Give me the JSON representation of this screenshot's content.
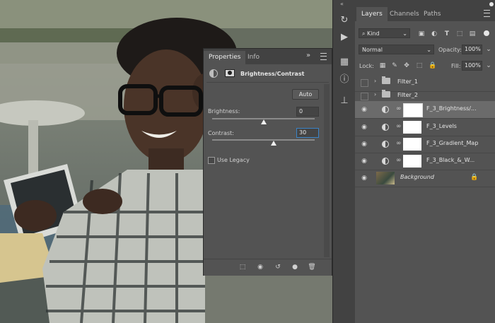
{
  "properties": {
    "tabs": [
      "Properties",
      "Info"
    ],
    "menu_glyph": "»",
    "title": "Brightness/Contrast",
    "auto_label": "Auto",
    "brightness_label": "Brightness:",
    "brightness_value": "0",
    "brightness_level": 0.5,
    "contrast_label": "Contrast:",
    "contrast_value": "30",
    "contrast_level": 0.6,
    "use_legacy_label": "Use Legacy",
    "use_legacy_checked": false
  },
  "layers_panel": {
    "tabs": [
      "Layers",
      "Channels",
      "Paths"
    ],
    "filter_kind": "Kind",
    "blend_mode": "Normal",
    "opacity_label": "Opacity:",
    "opacity_value": "100%",
    "lock_label": "Lock:",
    "fill_label": "Fill:",
    "fill_value": "100%",
    "layers": [
      {
        "name": "Filter_1",
        "type": "group",
        "visible": false,
        "selected": false
      },
      {
        "name": "Filter_2",
        "type": "group",
        "visible": false,
        "selected": false
      },
      {
        "name": "F_3_Brightness/...",
        "type": "adjustment",
        "visible": true,
        "selected": true
      },
      {
        "name": "F_3_Levels",
        "type": "adjustment",
        "visible": true,
        "selected": false
      },
      {
        "name": "F_3_Gradient_Map",
        "type": "adjustment",
        "visible": true,
        "selected": false
      },
      {
        "name": "F_3_Black_&_W...",
        "type": "adjustment",
        "visible": true,
        "selected": false
      },
      {
        "name": "Background",
        "type": "image",
        "visible": true,
        "selected": false
      }
    ]
  },
  "toolstrip": {
    "icons": [
      "history-icon",
      "play-actions-icon",
      "adjustments-icon",
      "info-icon",
      "stamp-icon"
    ]
  },
  "colors": {
    "panel_bg": "#535353",
    "panel_dark": "#424242",
    "selected_row": "#6b6b6b",
    "accent_input_border": "#3b84c7"
  }
}
